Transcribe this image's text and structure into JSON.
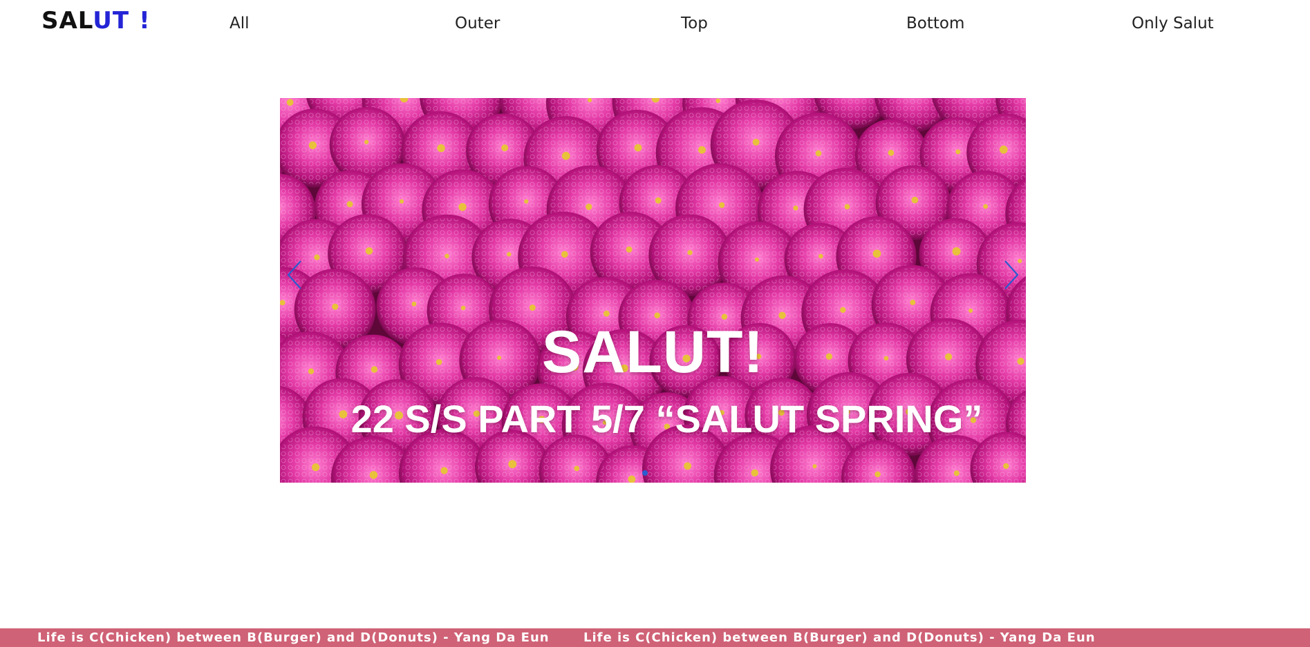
{
  "header": {
    "logo": {
      "part1": "SAL",
      "part2": "UT",
      "part3": "!"
    },
    "nav": [
      {
        "label": "All"
      },
      {
        "label": "Outer"
      },
      {
        "label": "Top"
      },
      {
        "label": "Bottom"
      },
      {
        "label": "Only Salut"
      }
    ]
  },
  "carousel": {
    "slide_title": "SALUT!",
    "slide_subtitle": "22 S/S PART 5/7  “SALUT SPRING”",
    "prev_icon": "chevron-left-icon",
    "next_icon": "chevron-right-icon",
    "active_slide": 1,
    "slide_count": 1
  },
  "footer": {
    "marquee_text": "Life is C(Chicken) between B(Burger) and D(Donuts) - Yang Da Eun"
  },
  "colors": {
    "logo_accent": "#2424d6",
    "arrow": "#2a5ccf",
    "footer_bar": "#cf6276",
    "flower_magenta": "#d21f8c"
  }
}
